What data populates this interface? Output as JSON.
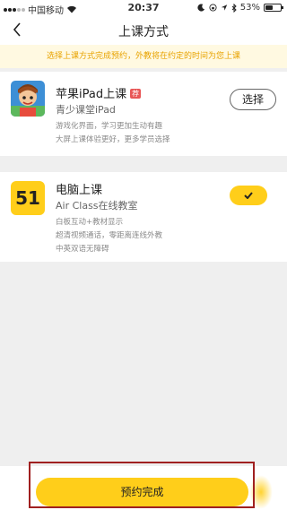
{
  "status_bar": {
    "carrier": "中国移动",
    "time": "20:37",
    "battery_pct": "53%",
    "battery_level": 0.53,
    "signal_bars": 3
  },
  "nav": {
    "back_icon": "chevron-left-icon",
    "title": "上课方式"
  },
  "tip": {
    "text": "选择上课方式完成预约，外教将在约定的时间为您上课"
  },
  "options": [
    {
      "title": "苹果iPad上课",
      "tag": "荐",
      "subtitle": "青少课堂iPad",
      "desc_lines": [
        "游戏化界面，学习更加生动有趣",
        "大屏上课体验更好，更多学员选择"
      ],
      "action_label": "选择",
      "selected": false
    },
    {
      "logo_text": "51",
      "title": "电脑上课",
      "subtitle": "Air Class在线教室",
      "desc_lines": [
        "白板互动+教材显示",
        "超清视频通话，零距离连线外教",
        "中英双语无障碍"
      ],
      "selected": true
    }
  ],
  "footer": {
    "submit_label": "预约完成"
  },
  "colors": {
    "accent": "#ffce1a",
    "tip_bg": "#fff9e1",
    "tip_text": "#e8a300",
    "tag": "#e85656",
    "page_bg": "#efefef"
  }
}
